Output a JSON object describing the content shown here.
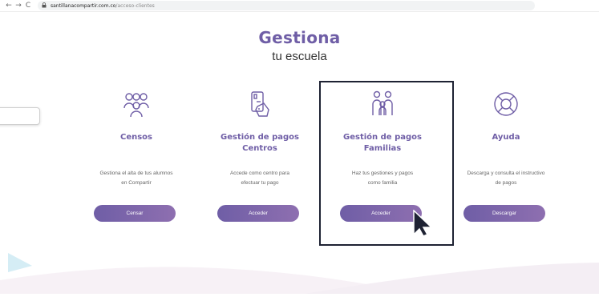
{
  "browser": {
    "back": "←",
    "forward": "→",
    "reload": "C",
    "url_domain": "santillanacompartir.com.co",
    "url_path": "/acceso-clientes"
  },
  "header": {
    "title": "Gestiona",
    "subtitle": "tu escuela"
  },
  "cards": [
    {
      "icon": "people-group-icon",
      "title": "Censos",
      "description": [
        "Gestiona el alta de tus alumnos",
        "en Compartir"
      ],
      "button": "Censar"
    },
    {
      "icon": "card-payment-icon",
      "title": [
        "Gestión de pagos",
        "Centros"
      ],
      "description": [
        "Accede como centro para",
        "efectuar tu pago"
      ],
      "button": "Acceder"
    },
    {
      "icon": "family-icon",
      "title": [
        "Gestión de pagos",
        "Familias"
      ],
      "description": [
        "Haz tus gestiones y pagos",
        "como familia"
      ],
      "button": "Acceder"
    },
    {
      "icon": "lifebuoy-icon",
      "title": "Ayuda",
      "description": [
        "Descarga y consulta el instructivo",
        "de pagos"
      ],
      "button": "Descargar"
    }
  ],
  "colors": {
    "accent": "#6f5ea6",
    "highlight_border": "#1e2233"
  }
}
